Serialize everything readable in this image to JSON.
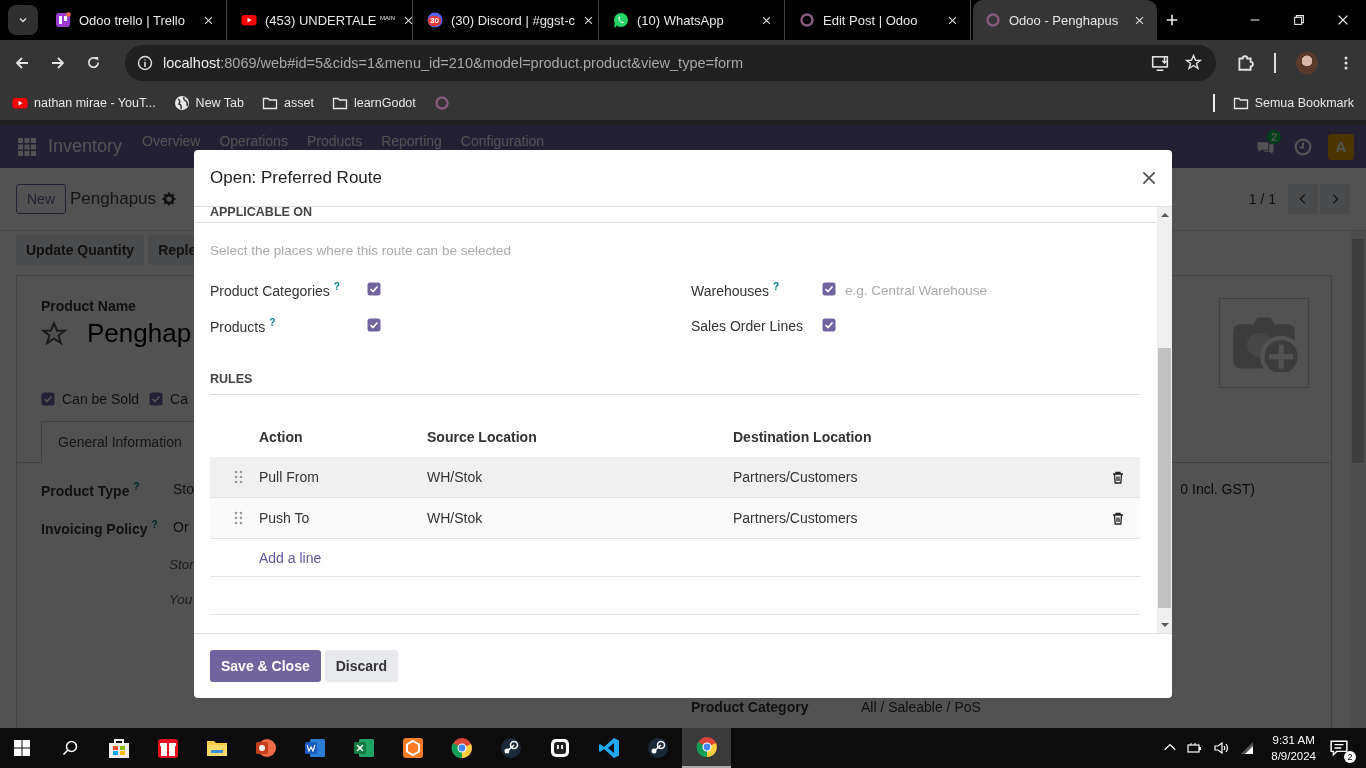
{
  "browser": {
    "tabs": [
      {
        "title": "Odoo trello | Trello",
        "selected": false
      },
      {
        "title": "(453) UNDERTALE $^{MAIN}$",
        "selected": false
      },
      {
        "title": "(30) Discord | #ggst-c",
        "badge": "30",
        "selected": false
      },
      {
        "title": "(10) WhatsApp",
        "selected": false
      },
      {
        "title": "Edit Post | Odoo",
        "selected": false
      },
      {
        "title": "Odoo - Penghapus",
        "selected": true
      }
    ],
    "address": {
      "host": "localhost",
      "path": ":8069/web#id=5&cids=1&menu_id=210&model=product.product&view_type=form"
    },
    "bookmarks": [
      "nathan mirae - YouT...",
      "New Tab",
      "asset",
      "learnGodot"
    ],
    "bookmark_folder": "Semua Bookmark"
  },
  "app": {
    "name": "Inventory",
    "menu": [
      "Overview",
      "Operations",
      "Products",
      "Reporting",
      "Configuration"
    ],
    "chat_count": "2",
    "avatar": "A"
  },
  "form": {
    "new_button": "New",
    "record": "Penghapus",
    "pager": "1 / 1",
    "actions": [
      "Update Quantity",
      "Reple"
    ],
    "name_label": "Product Name",
    "name_value": "Penghap",
    "options": [
      {
        "label": "Can be Sold",
        "checked": true
      },
      {
        "label": "Ca",
        "checked": true
      }
    ],
    "tabs": [
      {
        "label": "General Information",
        "selected": true
      }
    ],
    "fields": [
      {
        "label": "Product Type $^{?}$",
        "value": "Sto"
      },
      {
        "label": "Invoicing Policy $^{?}$",
        "value": "Or"
      }
    ],
    "notes": [
      "Stor",
      "You"
    ],
    "price_note": "0 Incl. GST)",
    "category": {
      "label": "Product Category",
      "value": "All / Saleable / PoS"
    }
  },
  "dialog": {
    "title": "Open: Preferred Route",
    "applicable": {
      "heading": "APPLICABLE ON",
      "hint": "Select the places where this route can be selected",
      "left": [
        {
          "label": "Product Categories $^{?}$",
          "checked": true
        },
        {
          "label": "Products $^{?}$",
          "checked": true
        }
      ],
      "right": [
        {
          "label": "Warehouses $^{?}$",
          "checked": true,
          "placeholder": "e.g. Central Warehouse"
        },
        {
          "label": "Sales Order Lines",
          "checked": true
        }
      ]
    },
    "rules": {
      "heading": "RULES",
      "columns": [
        "Action",
        "Source Location",
        "Destination Location"
      ],
      "rows": [
        {
          "action": "Pull From",
          "source": "WH/Stok",
          "destination": "Partners/Customers"
        },
        {
          "action": "Push To",
          "source": "WH/Stok",
          "destination": "Partners/Customers"
        }
      ],
      "add_line": "Add a line"
    },
    "buttons": [
      {
        "label": "Save & Close",
        "kind": "primary"
      },
      {
        "label": "Discard",
        "kind": "secondary"
      }
    ]
  },
  "taskbar": {
    "apps": [
      {
        "kind": "store",
        "selected": false
      },
      {
        "kind": "gift",
        "selected": false
      },
      {
        "kind": "folder",
        "selected": false
      },
      {
        "kind": "slides",
        "selected": false
      },
      {
        "kind": "document",
        "selected": false
      },
      {
        "kind": "sheet",
        "selected": false
      },
      {
        "kind": "hexagon",
        "selected": false
      },
      {
        "kind": "browser",
        "selected": false
      },
      {
        "kind": "game",
        "selected": false
      },
      {
        "kind": "face",
        "selected": false
      },
      {
        "kind": "code",
        "selected": false
      },
      {
        "kind": "game",
        "selected": false
      },
      {
        "kind": "browser",
        "selected": true
      }
    ],
    "time": "9:31 AM",
    "date": "8/9/2024",
    "notifications": "2"
  }
}
